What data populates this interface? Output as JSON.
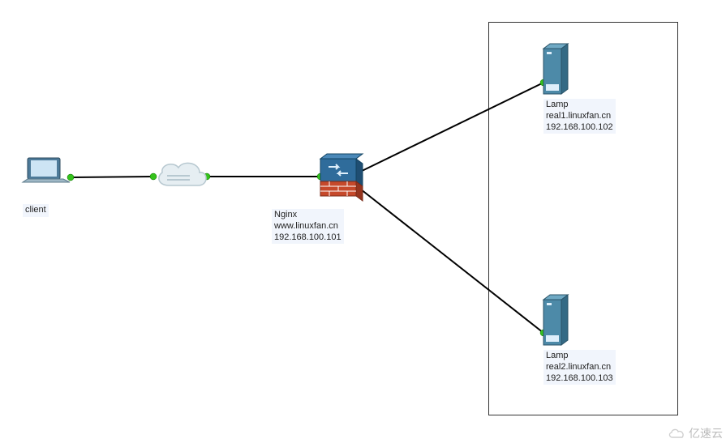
{
  "nodes": {
    "client": {
      "label": "client"
    },
    "nginx": {
      "label_line1": "Nginx",
      "label_line2": "www.linuxfan.cn",
      "label_line3": "192.168.100.101"
    },
    "server1": {
      "label_line1": "Lamp",
      "label_line2": "real1.linuxfan.cn",
      "label_line3": "192.168.100.102"
    },
    "server2": {
      "label_line1": "Lamp",
      "label_line2": "real2.linuxfan.cn",
      "label_line3": "192.168.100.103"
    }
  },
  "watermark": {
    "text": "亿速云"
  }
}
